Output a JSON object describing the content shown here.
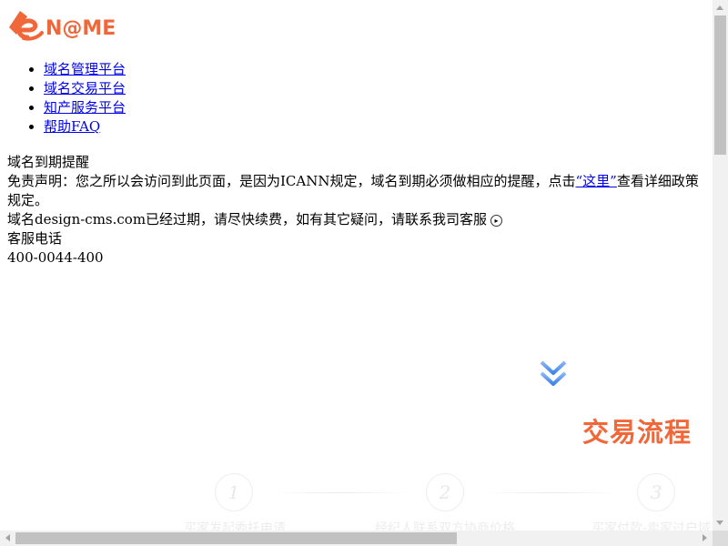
{
  "brand": {
    "logo_text": "N@ME",
    "color": "#f0683a"
  },
  "nav": {
    "items": [
      {
        "label": "域名管理平台"
      },
      {
        "label": "域名交易平台"
      },
      {
        "label": "知产服务平台"
      },
      {
        "label": "帮助FAQ"
      }
    ]
  },
  "notice": {
    "title": "域名到期提醒",
    "disclaimer_prefix": "免责声明：您之所以会访问到此页面，是因为ICANN规定，域名到期必须做相应的提醒，点击",
    "disclaimer_link": "“这里”",
    "disclaimer_suffix": "查看详细政策规定。",
    "expired_message": "域名design-cms.com已经过期，请尽快续费，如有其它疑问，请联系我司客服",
    "service_label": "客服电话",
    "service_phone": "400-0044-400"
  },
  "process": {
    "title": "交易流程",
    "steps": [
      {
        "number": "1",
        "label": "买家发起委托申请"
      },
      {
        "number": "2",
        "label": "经纪人联系双方协商价格"
      },
      {
        "number": "3",
        "label": "买家付款-卖家过户域"
      }
    ]
  },
  "icons": {
    "chevron": "double-chevron-down-icon",
    "circle_arrow": "circle-arrow-right-icon"
  }
}
